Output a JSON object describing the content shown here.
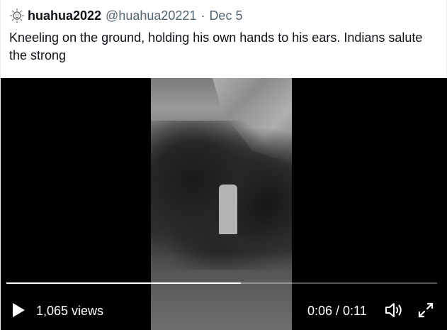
{
  "tweet": {
    "display_name": "huahua2022",
    "handle": "@huahua20221",
    "separator": "·",
    "date": "Dec 5",
    "text": "Kneeling on the ground, holding his own hands to his ears. Indians salute the strong",
    "avatar_icon": "sun-sketch-avatar-icon"
  },
  "video": {
    "views": "1,065 views",
    "time": "0:06 / 0:11",
    "progress_fraction": 0.545,
    "play_icon": "play-icon",
    "volume_icon": "volume-icon",
    "fullscreen_icon": "fullscreen-expand-icon"
  },
  "colors": {
    "text_primary": "#0f1419",
    "text_secondary": "#536471",
    "video_background": "#000000",
    "controls": "#ffffff"
  }
}
